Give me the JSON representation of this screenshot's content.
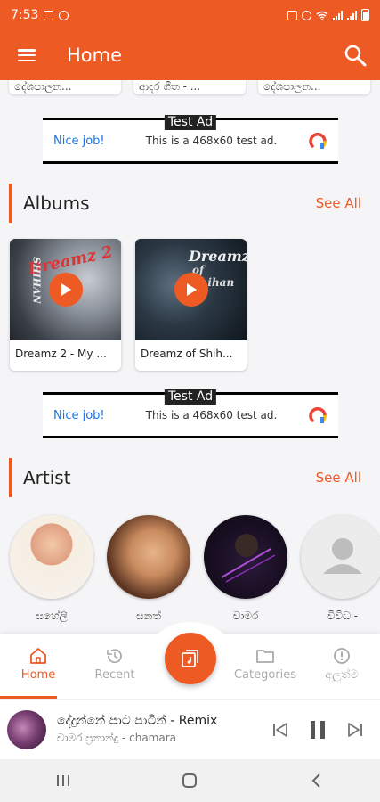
{
  "status_bar": {
    "time": "7:53"
  },
  "app_bar": {
    "title": "Home"
  },
  "top_cards": [
    "දේශපාලන...",
    "ආදර ගීත - ...",
    "දේශපාලන..."
  ],
  "ads": [
    {
      "tag": "Test Ad",
      "cta": "Nice job!",
      "text": "This is a 468x60 test ad."
    },
    {
      "tag": "Test Ad",
      "cta": "Nice job!",
      "text": "This is a 468x60 test ad."
    }
  ],
  "albums_section": {
    "title": "Albums",
    "see_all": "See All",
    "items": [
      {
        "title": "Dreamz 2 - My ..."
      },
      {
        "title": "Dreamz of Shih..."
      }
    ]
  },
  "artists_section": {
    "title": "Artist",
    "see_all": "See All",
    "items": [
      {
        "name": "සහේලි"
      },
      {
        "name": "සනත්"
      },
      {
        "name": "චාමර"
      },
      {
        "name": "විවිධ -"
      }
    ]
  },
  "bottom_nav": {
    "items": [
      {
        "label": "Home",
        "icon": "home-icon",
        "active": true
      },
      {
        "label": "Recent",
        "icon": "history-icon",
        "active": false
      },
      {
        "label": "Categories",
        "icon": "folder-icon",
        "active": false
      },
      {
        "label": "අලුත්ම",
        "icon": "new-alert-icon",
        "active": false
      }
    ],
    "fab_icon": "music-library-icon"
  },
  "now_playing": {
    "title": "දේදුන්නේ පාට පාටින් - Remix",
    "artist": "චාමර ප්‍රනාන්දු - chamara"
  },
  "colors": {
    "accent": "#ee5a24",
    "link": "#1a73e8"
  }
}
